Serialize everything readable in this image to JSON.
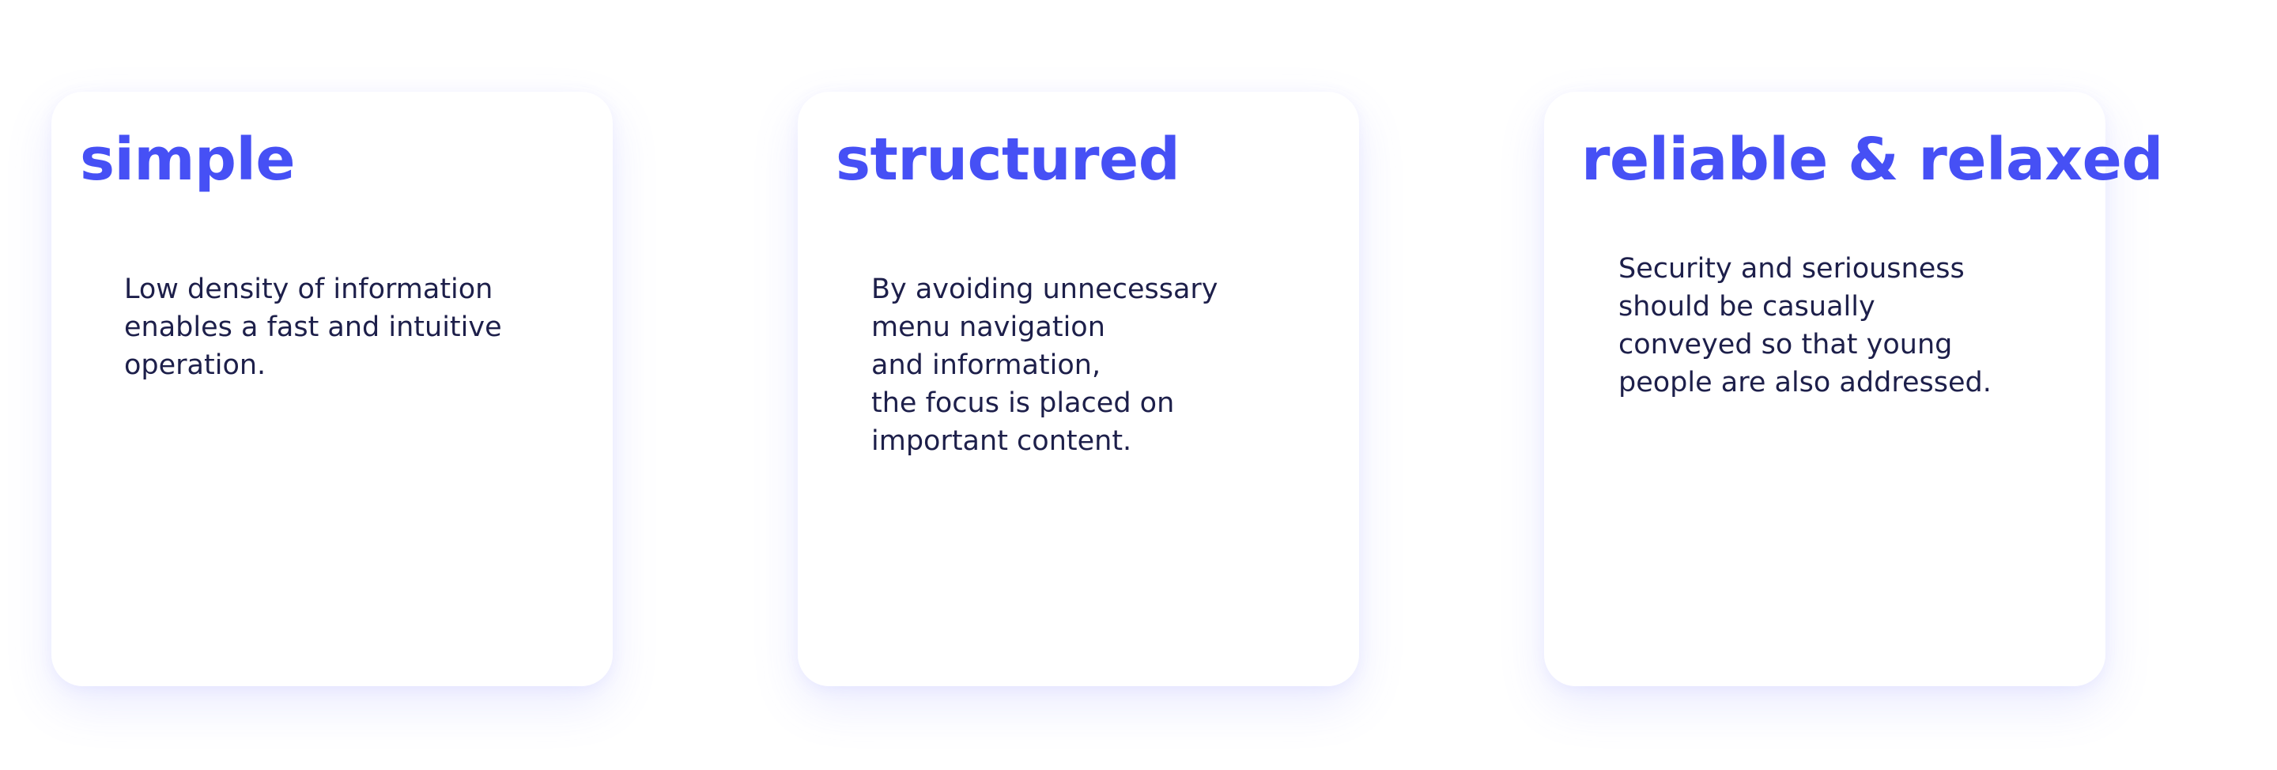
{
  "cards": [
    {
      "title": "simple",
      "body": "Low density of information\nenables a fast and intuitive\noperation."
    },
    {
      "title": "structured",
      "body": "By avoiding unnecessary\nmenu navigation\nand information,\nthe focus is placed on\nimportant content."
    },
    {
      "title": "reliable & relaxed",
      "body": "Security and seriousness\nshould be casually\nconveyed so that young\npeople are also addressed."
    }
  ],
  "colors": {
    "title": "#4650f5",
    "body_text": "#1d1f4a",
    "card_background": "#ffffff",
    "card_shadow": "#6e78ff"
  }
}
